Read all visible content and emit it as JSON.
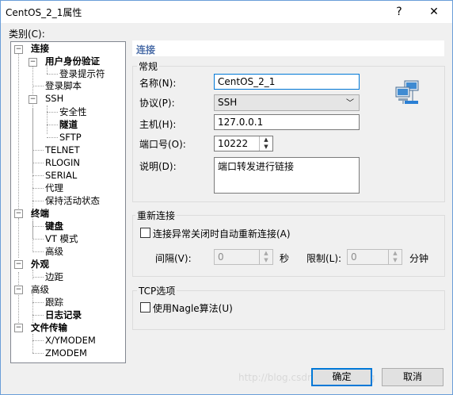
{
  "window": {
    "title": "CentOS_2_1属性",
    "help_btn": "?",
    "close_btn": "✕"
  },
  "category_label": "类别(C):",
  "tree": {
    "items": [
      {
        "label": "连接",
        "bold": true
      },
      {
        "label": "用户身份验证",
        "bold": true
      },
      {
        "label": "登录提示符",
        "bold": false
      },
      {
        "label": "登录脚本",
        "bold": false
      },
      {
        "label": "SSH",
        "bold": false
      },
      {
        "label": "安全性",
        "bold": false
      },
      {
        "label": "隧道",
        "bold": true
      },
      {
        "label": "SFTP",
        "bold": false
      },
      {
        "label": "TELNET",
        "bold": false
      },
      {
        "label": "RLOGIN",
        "bold": false
      },
      {
        "label": "SERIAL",
        "bold": false
      },
      {
        "label": "代理",
        "bold": false
      },
      {
        "label": "保持活动状态",
        "bold": false
      },
      {
        "label": "终端",
        "bold": true
      },
      {
        "label": "键盘",
        "bold": true
      },
      {
        "label": "VT 模式",
        "bold": false
      },
      {
        "label": "高级",
        "bold": false
      },
      {
        "label": "外观",
        "bold": true
      },
      {
        "label": "边距",
        "bold": false
      },
      {
        "label": "高级",
        "bold": false
      },
      {
        "label": "跟踪",
        "bold": false
      },
      {
        "label": "日志记录",
        "bold": true
      },
      {
        "label": "文件传输",
        "bold": true
      },
      {
        "label": "X/YMODEM",
        "bold": false
      },
      {
        "label": "ZMODEM",
        "bold": false
      }
    ],
    "expander_collapse": "−"
  },
  "panel": {
    "header": "连接",
    "general": {
      "group_label": "常规",
      "name_label": "名称(N):",
      "name_value": "CentOS_2_1",
      "protocol_label": "协议(P):",
      "protocol_value": "SSH",
      "protocol_arrow": "﹀",
      "host_label": "主机(H):",
      "host_value": "127.0.0.1",
      "port_label": "端口号(O):",
      "port_value": "10222",
      "desc_label": "说明(D):",
      "desc_value": "端口转发进行链接"
    },
    "reconnect": {
      "group_label": "重新连接",
      "checkbox_label": "连接异常关闭时自动重新连接(A)",
      "checked": false,
      "interval_label": "间隔(V):",
      "interval_value": "0",
      "seconds_label": "秒",
      "limit_label": "限制(L):",
      "limit_value": "0",
      "minutes_label": "分钟"
    },
    "tcp": {
      "group_label": "TCP选项",
      "nagle_label": "使用Nagle算法(U)",
      "checked": false
    }
  },
  "spin_up": "▲",
  "spin_down": "▼",
  "buttons": {
    "ok": "确定",
    "cancel": "取消"
  },
  "watermark": "http://blog.csdn.net/lileiyang"
}
